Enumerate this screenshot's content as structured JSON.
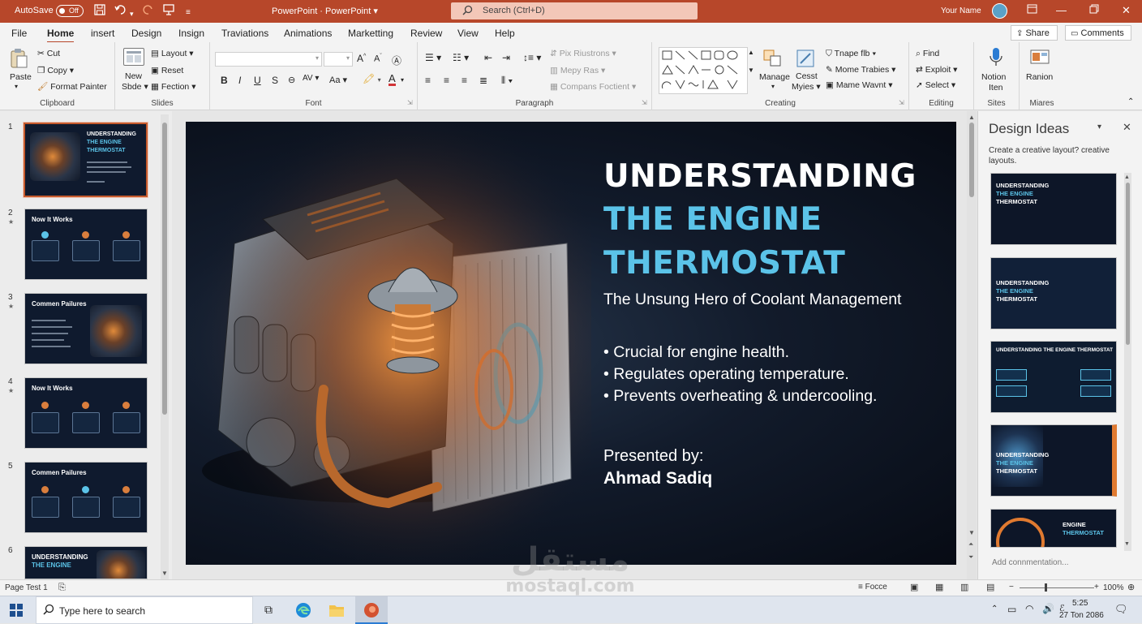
{
  "titlebar": {
    "autosave_label": "AutoSave",
    "autosave_state": "Off",
    "doc_title": "PowerPoint  ·  PowerPoint",
    "search_placeholder": "Search (Ctrl+D)",
    "user_name": "Your Name"
  },
  "menu": {
    "items": [
      "File",
      "Home",
      "insert",
      "Design",
      "Insign",
      "Traviations",
      "Animations",
      "Marketting",
      "Review",
      "View",
      "Help"
    ],
    "active": "Home",
    "share_label": "Share",
    "comments_label": "Comments"
  },
  "ribbon": {
    "clipboard": {
      "label": "Clipboard",
      "paste": "Paste",
      "cut": "Cut",
      "copy": "Copy",
      "format_painter": "Format Painter"
    },
    "slides": {
      "label": "Slides",
      "new_slide_1": "New",
      "new_slide_2": "Sbde",
      "layout": "Layout",
      "reset": "Reset",
      "section": "Fection"
    },
    "font": {
      "label": "Font"
    },
    "paragraph": {
      "label": "Paragraph",
      "text_direction": "Pix Riustrons",
      "align_text": "Mepy Ras",
      "convert_smartart": "Compans Foctient"
    },
    "drawing": {
      "label": "Creating",
      "arrange": "Manage",
      "quick_styles_1": "Cesst",
      "quick_styles_2": "Myies",
      "shape_fill": "Tnape flb",
      "shape_outline": "Mome Trabies",
      "shape_effects": "Mame Wavnt"
    },
    "editing": {
      "label": "Editing",
      "find": "Find",
      "replace": "Exploit",
      "select": "Select"
    },
    "sites": {
      "label": "Sites",
      "btn_1": "Notion",
      "btn_2": "Iten"
    },
    "miares": {
      "label": "Miares",
      "btn": "Ranion"
    }
  },
  "thumbnails": [
    {
      "num": "1",
      "title_1": "UNDERSTANDING",
      "title_2": "THE ENGINE",
      "title_3": "THERMOSTAT",
      "selected": true
    },
    {
      "num": "2",
      "title_1": "Now It Works"
    },
    {
      "num": "3",
      "title_1": "Commen Pailures"
    },
    {
      "num": "4",
      "title_1": "Now It Works"
    },
    {
      "num": "5",
      "title_1": "Commen Pailures"
    },
    {
      "num": "6",
      "title_1": "UNDERSTANDING",
      "title_2": "THE ENGINE"
    }
  ],
  "slide": {
    "title_line1": "UNDERSTANDING",
    "title_line2": "THE ENGINE",
    "title_line3": "THERMOSTAT",
    "subtitle": "The Unsung Hero of Coolant Management",
    "bullets": [
      "Crucial for engine health.",
      "Regulates operating temperature.",
      "Prevents overheating & undercooling."
    ],
    "presented_by": "Presented by:",
    "presenter": "Ahmad Sadiq"
  },
  "design_ideas": {
    "title": "Design Ideas",
    "description": "Create a creative layout? creative layouts.",
    "ideas": [
      {
        "t1": "UNDERSTANDING",
        "t2": "THE ENGINE",
        "t3": "THERMOSTAT"
      },
      {
        "t1": "UNDERSTANDING",
        "t2": "THE ENGINE",
        "t3": "THERMOSTAT"
      },
      {
        "t1": "UNDERSTANDING THE ENGINE THERMOSTAT",
        "t2": "",
        "t3": ""
      },
      {
        "t1": "UNDERSTANDING",
        "t2": "THE ENGINE",
        "t3": "THERMOSTAT"
      },
      {
        "t1": "ENGINE",
        "t2": "THERMOSTAT",
        "t3": ""
      }
    ],
    "add_comment": "Add connmentation..."
  },
  "statusbar": {
    "slide_info": "Page Test 1",
    "notes": "Focce",
    "zoom": "100%"
  },
  "taskbar": {
    "search_placeholder": "Type here to search",
    "time": "5:25",
    "date": "27 Ton 2086"
  },
  "watermark": {
    "line1": "مستقل",
    "line2": "mostaql.com"
  },
  "colors": {
    "accent": "#b7472a",
    "title_blue": "#5bc3e8",
    "slide_bg": "#0f1827"
  }
}
